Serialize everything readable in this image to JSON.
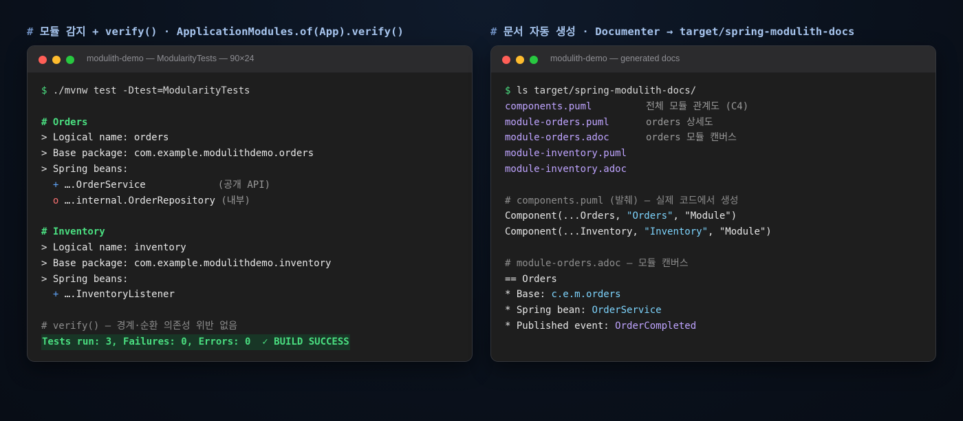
{
  "left": {
    "heading": "모듈 감지 + verify() · ApplicationModules.of(App).verify()",
    "window_title": "modulith-demo — ModularityTests — 90×24",
    "command": "./mvnw test -Dtest=ModularityTests",
    "orders": {
      "section": "# Orders",
      "logical": "> Logical name: orders",
      "base": "> Base package: com.example.modulithdemo.orders",
      "beans": "> Spring beans:",
      "bean1_mark": "+",
      "bean1": "….OrderService",
      "bean1_note": "(공개 API)",
      "bean2_mark": "o",
      "bean2": "….internal.OrderRepository",
      "bean2_note": "(내부)"
    },
    "inventory": {
      "section": "# Inventory",
      "logical": "> Logical name: inventory",
      "base": "> Base package: com.example.modulithdemo.inventory",
      "beans": "> Spring beans:",
      "bean1_mark": "+",
      "bean1": "….InventoryListener"
    },
    "verify_comment": "# verify() — 경계·순환 의존성 위반 없음",
    "result": "Tests run: 3, Failures: 0, Errors: 0  ✓ BUILD SUCCESS"
  },
  "right": {
    "heading": "문서 자동 생성 · Documenter → target/spring-modulith-docs",
    "window_title": "modulith-demo — generated docs",
    "command": "ls target/spring-modulith-docs/",
    "files": [
      {
        "name": "components.puml",
        "note": "전체 모듈 관계도 (C4)"
      },
      {
        "name": "module-orders.puml",
        "note": "orders 상세도"
      },
      {
        "name": "module-orders.adoc",
        "note": "orders 모듈 캔버스"
      },
      {
        "name": "module-inventory.puml",
        "note": ""
      },
      {
        "name": "module-inventory.adoc",
        "note": ""
      }
    ],
    "puml_comment": "# components.puml (발췌) — 실제 코드에서 생성",
    "comp1_pre": "Component(...Orders, ",
    "comp1_str": "\"Orders\"",
    "comp1_post": ", \"Module\")",
    "comp2_pre": "Component(...Inventory, ",
    "comp2_str": "\"Inventory\"",
    "comp2_post": ", \"Module\")",
    "adoc_comment": "# module-orders.adoc — 모듈 캔버스",
    "adoc_title": "== Orders",
    "adoc_base_label": "* Base: ",
    "adoc_base_value": "c.e.m.orders",
    "adoc_bean_label": "* Spring bean: ",
    "adoc_bean_value": "OrderService",
    "adoc_event_label": "* Published event: ",
    "adoc_event_value": "OrderCompleted"
  }
}
